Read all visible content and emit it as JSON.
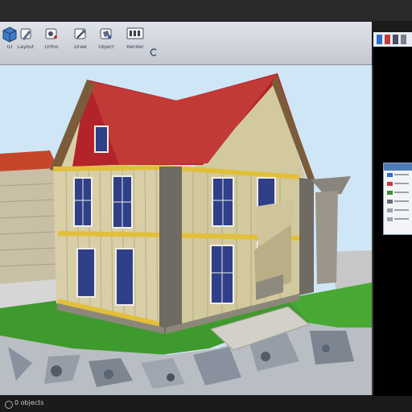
{
  "toolbar": {
    "buttons": [
      {
        "label": "ID",
        "icon": "cube-icon"
      },
      {
        "label": "Layout",
        "icon": "pencil-icon"
      },
      {
        "label": "Ortho",
        "icon": "brush-icon"
      },
      {
        "label": "Draw",
        "icon": "wand-icon"
      },
      {
        "label": "Object",
        "icon": "bucket-icon"
      },
      {
        "label": "Render",
        "icon": "render-icon"
      }
    ]
  },
  "status": {
    "text": "0 objects"
  },
  "colors": {
    "roof": "#b3242a",
    "siding": "#d8cfa8",
    "trim": "#e2bf3a",
    "grass": "#3f9a2d",
    "sky": "#cfe6f6"
  }
}
